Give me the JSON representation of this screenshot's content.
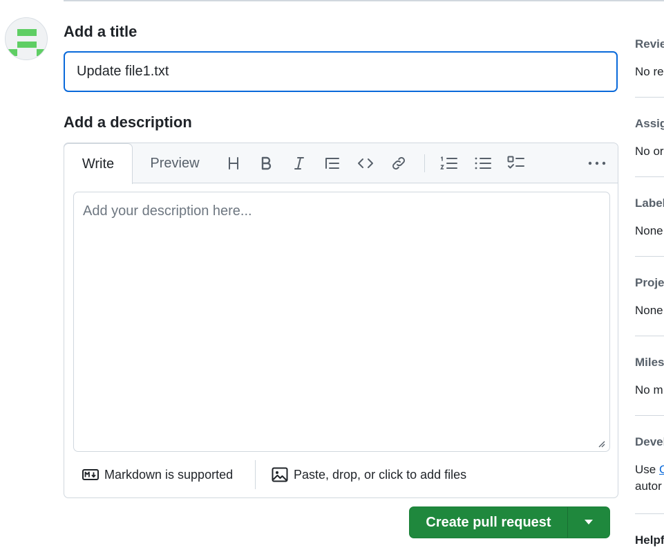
{
  "form": {
    "title_label": "Add a title",
    "title_value": "Update file1.txt",
    "description_label": "Add a description",
    "description_placeholder": "Add your description here..."
  },
  "editor": {
    "tabs": {
      "write": "Write",
      "preview": "Preview"
    },
    "toolbar_icons": [
      "heading-icon",
      "bold-icon",
      "italic-icon",
      "quote-icon",
      "code-icon",
      "link-icon",
      "numbered-list-icon",
      "unordered-list-icon",
      "task-list-icon",
      "more-options-icon"
    ],
    "footer": {
      "markdown": "Markdown is supported",
      "attach": "Paste, drop, or click to add files"
    }
  },
  "actions": {
    "create_label": "Create pull request"
  },
  "sidebar": {
    "reviewers": {
      "heading": "Revie",
      "value": "No re"
    },
    "assignees": {
      "heading": "Assig",
      "value": "No or"
    },
    "labels": {
      "heading": "Label",
      "value": "None"
    },
    "projects": {
      "heading": "Proje",
      "value": "None"
    },
    "milestone": {
      "heading": "Miles",
      "value": "No m"
    },
    "development": {
      "heading": "Devel",
      "value_prefix": "Use",
      "value_link": "C",
      "value_line2": "autor"
    },
    "helpful": {
      "heading": "Helpf"
    }
  },
  "colors": {
    "accent": "#0969da",
    "primary_button": "#1f883d",
    "avatar_green": "#5fce64",
    "border": "#d0d7de"
  }
}
